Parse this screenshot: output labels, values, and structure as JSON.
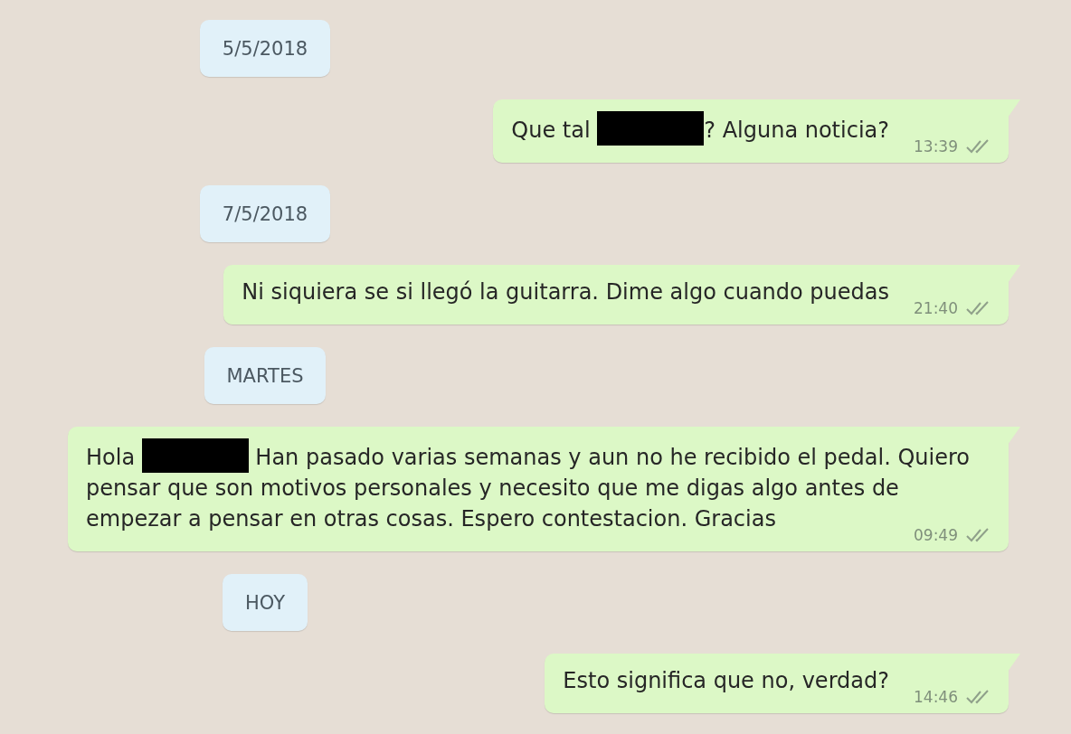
{
  "chat": [
    {
      "kind": "date",
      "label": "5/5/2018"
    },
    {
      "kind": "message",
      "parts": [
        {
          "kind": "text",
          "text": "Que tal "
        },
        {
          "kind": "redaction"
        },
        {
          "kind": "text",
          "text": "? Alguna noticia?"
        }
      ],
      "time": "13:39",
      "read": false
    },
    {
      "kind": "date",
      "label": "7/5/2018"
    },
    {
      "kind": "message",
      "parts": [
        {
          "kind": "text",
          "text": "Ni siquiera se si llegó la guitarra. Dime algo cuando puedas"
        }
      ],
      "time": "21:40",
      "read": false
    },
    {
      "kind": "date",
      "label": "MARTES"
    },
    {
      "kind": "message",
      "parts": [
        {
          "kind": "text",
          "text": "Hola "
        },
        {
          "kind": "redaction"
        },
        {
          "kind": "text",
          "text": " Han pasado varias semanas y aun no he recibido el pedal. Quiero pensar que son motivos personales y necesito que me digas algo antes de empezar a pensar en otras cosas. Espero contestacion. Gracias"
        }
      ],
      "time": "09:49",
      "read": false
    },
    {
      "kind": "date",
      "label": "HOY"
    },
    {
      "kind": "message",
      "parts": [
        {
          "kind": "text",
          "text": "Esto significa que no, verdad?"
        }
      ],
      "time": "14:46",
      "read": false
    }
  ]
}
